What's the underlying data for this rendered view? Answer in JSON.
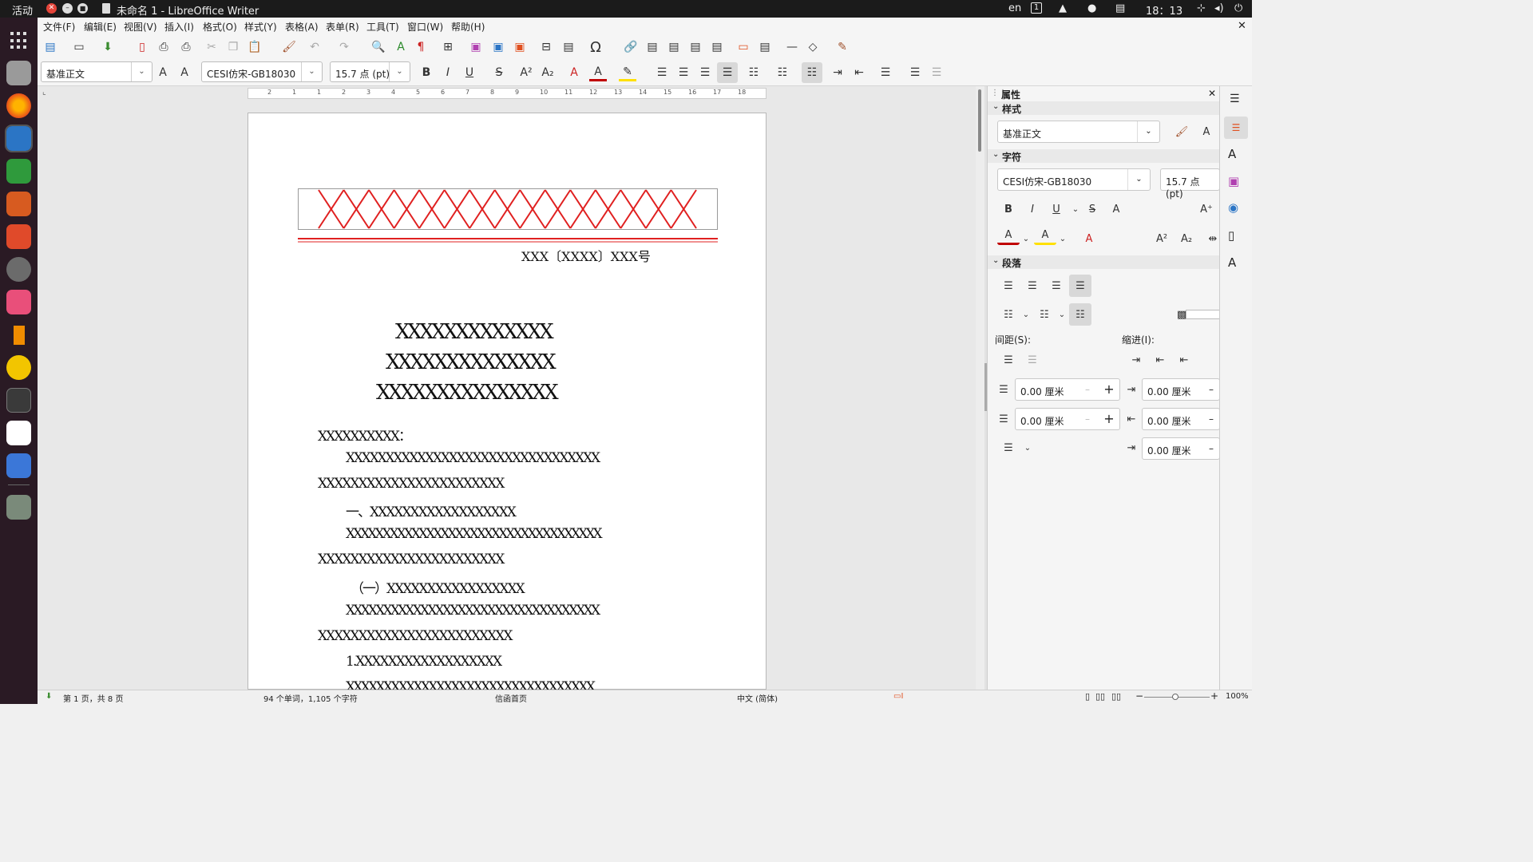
{
  "topbar": {
    "activities": "活动",
    "window_title": "未命名 1 - LibreOffice Writer",
    "lang": "en",
    "input_method": "1",
    "time": "18：13"
  },
  "menu": [
    "文件(F)",
    "编辑(E)",
    "视图(V)",
    "插入(I)",
    "格式(O)",
    "样式(Y)",
    "表格(A)",
    "表单(R)",
    "工具(T)",
    "窗口(W)",
    "帮助(H)"
  ],
  "toolbar": {
    "para_style": "基准正文",
    "font_name": "CESI仿宋-GB18030",
    "font_size": "15.7 点 (pt)"
  },
  "ruler": {
    "ticks": [
      "2",
      "1",
      "1",
      "2",
      "3",
      "4",
      "5",
      "6",
      "7",
      "8",
      "9",
      "10",
      "11",
      "12",
      "13",
      "14",
      "15",
      "16",
      "17",
      "18"
    ]
  },
  "document": {
    "doc_number": "XXX〔XXXX〕XXX号",
    "title_lines": [
      "XXXXXXXXXXXXX",
      "XXXXXXXXXXXXXX",
      "XXXXXXXXXXXXXXX"
    ],
    "salutation": "XXXXXXXXXX：",
    "body": [
      "XXXXXXXXXXXXXXXXXXXXXXXXXXXXXXXX",
      "XXXXXXXXXXXXXXXXXXXXXXX",
      "一、XXXXXXXXXXXXXXXXXX",
      "XXXXXXXXXXXXXXXXXXXXXXXXXXXXXXXXXXX",
      "XXXXXXXXXXXXXXXXXXXXXXX",
      "（一）XXXXXXXXXXXXXXXXX",
      "XXXXXXXXXXXXXXXXXXXXXXXXXXXXXXXXXX",
      "XXXXXXXXXXXXXXXXXXXXXXXX",
      "1.XXXXXXXXXXXXXXXXXX",
      "XXXXXXXXXXXXXXXXXXXXXXXXXXXXXXXXX"
    ]
  },
  "sidebar": {
    "title": "属性",
    "style_section": "样式",
    "style_value": "基准正文",
    "char_section": "字符",
    "font_value": "CESI仿宋-GB18030",
    "size_value": "15.7 点 (pt)",
    "para_section": "段落",
    "spacing_label": "间距(S):",
    "indent_label": "缩进(I):",
    "above_spacing": "0.00 厘米",
    "below_spacing": "0.00 厘米",
    "before_indent": "0.00 厘米",
    "after_indent": "0.00 厘米",
    "first_line_indent": "0.00 厘米"
  },
  "status": {
    "page": "第 1 页，共 8 页",
    "words": "94 个单词，1,105 个字符",
    "page_style": "信函首页",
    "language": "中文 (简体)",
    "zoom": "100%"
  },
  "colors": {
    "accent_red": "#e02020",
    "font_color": "#c00000",
    "highlight": "#ffe000"
  }
}
